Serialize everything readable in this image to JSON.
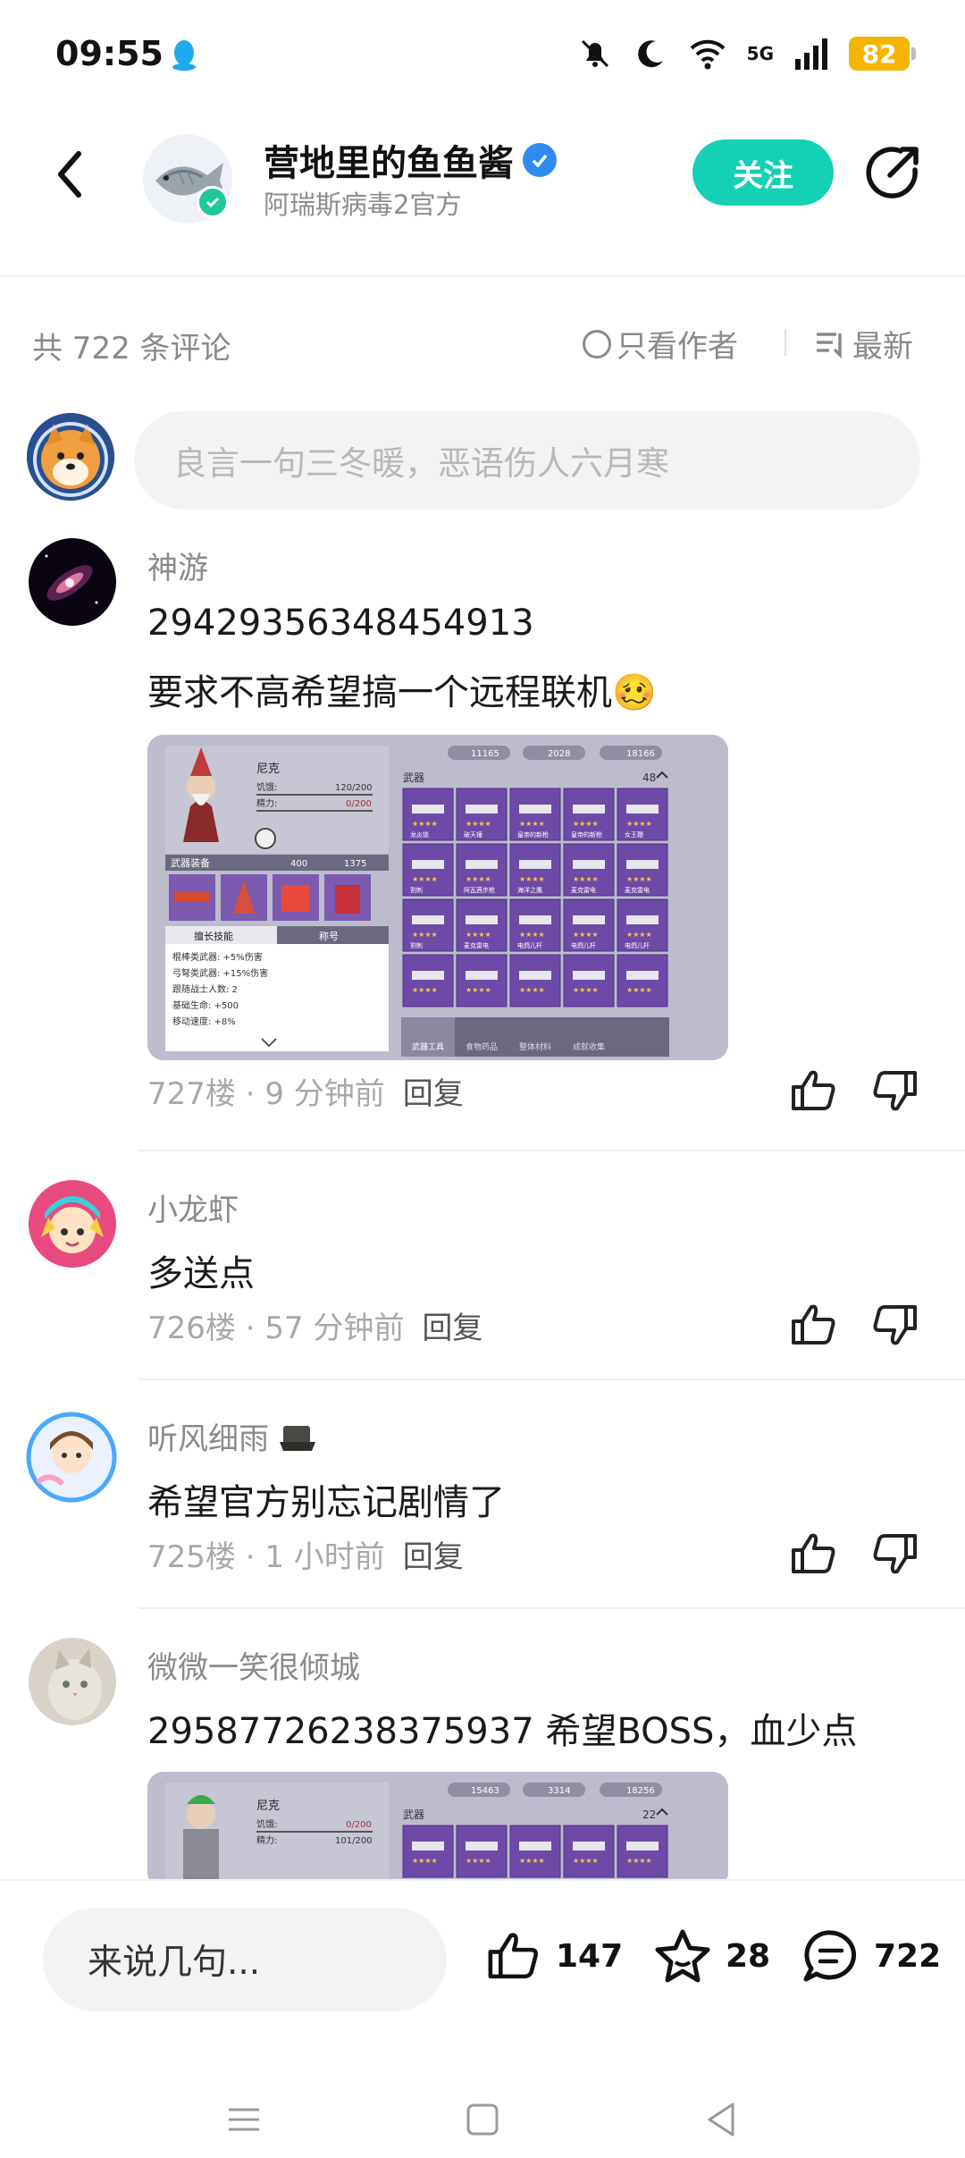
{
  "status_bar": {
    "time": "09:55",
    "battery": "82",
    "network": "5G"
  },
  "header": {
    "account_name": "营地里的鱼鱼酱",
    "subtitle": "阿瑞斯病毒2官方",
    "follow_label": "关注"
  },
  "toolbar": {
    "comment_count": "共 722 条评论",
    "only_author": "只看作者",
    "sort": "最新"
  },
  "comment_input": {
    "placeholder": "良言一句三冬暖，恶语伤人六月寒"
  },
  "comments": [
    {
      "user": "神游",
      "lines": [
        "29429356348454913",
        "要求不高希望搞一个远程联机🥴"
      ],
      "floor": "727楼",
      "time": "9 分钟前",
      "reply": "回复",
      "has_image": true
    },
    {
      "user": "小龙虾",
      "lines": [
        "多送点"
      ],
      "floor": "726楼",
      "time": "57 分钟前",
      "reply": "回复",
      "has_image": false
    },
    {
      "user": "听风细雨",
      "lines": [
        "希望官方别忘记剧情了"
      ],
      "floor": "725楼",
      "time": "1 小时前",
      "reply": "回复",
      "has_image": false
    },
    {
      "user": "微微一笑很倾城",
      "lines": [
        "29587726238375937 希望BOSS，血少点"
      ],
      "has_image": true
    }
  ],
  "game_screenshot_1": {
    "character": "尼克",
    "stats": [
      "饥饿:",
      "120/200",
      "精力:",
      "0/200"
    ],
    "currency": [
      "11165",
      "2028",
      "18166"
    ],
    "weapons_label": "武器",
    "weapons_count": "48",
    "equip_label": "武器装备",
    "equip_stats": [
      "400",
      "1375"
    ],
    "skill_tabs": [
      "擅长技能",
      "称号"
    ],
    "skills": [
      "棍棒类武器: +5%伤害",
      "弓弩类武器: +15%伤害",
      "跟随战士人数: 2",
      "基础生命: +500",
      "移动速度: +8%"
    ],
    "weapon_names": [
      "龙炎锁",
      "破天锤",
      "皇帝的新枪",
      "皇帝的新枪",
      "女王鞭",
      "割刺",
      "阿瓦茜步枪",
      "海洋之鹰",
      "麦克雷电",
      "麦克雷电",
      "割刺",
      "麦克雷电",
      "电鸽儿杆",
      "电鸽儿杆",
      "电鸽儿杆"
    ],
    "bottom_tabs": [
      "武器工具",
      "食物药品",
      "整体材料",
      "成就收集"
    ]
  },
  "game_screenshot_2": {
    "character": "尼克",
    "stats": [
      "饥饿:",
      "0/200",
      "精力:",
      "101/200"
    ],
    "currency": [
      "15463",
      "3314",
      "18256"
    ],
    "weapons_label": "武器",
    "weapons_count": "22"
  },
  "bottom_bar": {
    "input_placeholder": "来说几句...",
    "likes": "147",
    "stars": "28",
    "comments": "722"
  },
  "colors": {
    "accent": "#14d0b4",
    "battery": "#f5b400",
    "verified": "#1fc79a",
    "muted": "#8a8a8a"
  }
}
